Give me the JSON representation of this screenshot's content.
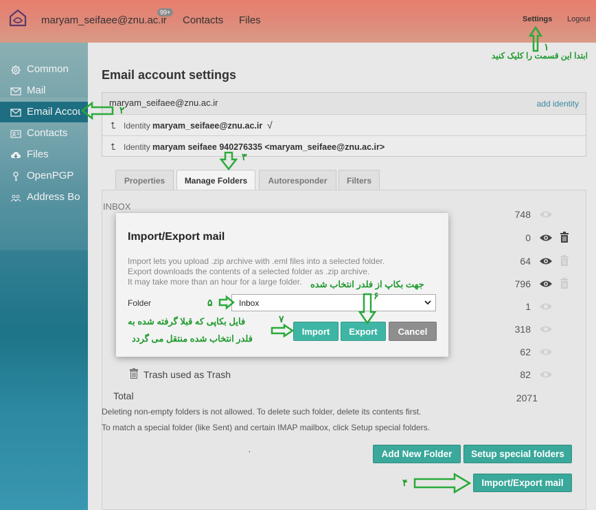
{
  "topbar": {
    "user": "maryam_seifaee@znu.ac.ir",
    "badge": "99+",
    "contacts": "Contacts",
    "files": "Files",
    "settings": "Settings",
    "logout": "Logout"
  },
  "sidebar": {
    "items": [
      {
        "label": "Common",
        "icon": "gear-icon"
      },
      {
        "label": "Mail",
        "icon": "envelope-icon"
      },
      {
        "label": "Email Accounts",
        "icon": "envelope-icon"
      },
      {
        "label": "Contacts",
        "icon": "contact-card-icon"
      },
      {
        "label": "Files",
        "icon": "cloud-download-icon"
      },
      {
        "label": "OpenPGP",
        "icon": "key-icon"
      },
      {
        "label": "Address Book",
        "icon": "people-icon"
      }
    ]
  },
  "main": {
    "title": "Email account settings",
    "account": "maryam_seifaee@znu.ac.ir",
    "add_identity": "add identity",
    "identity_prefix": "Identity",
    "identities": [
      {
        "name": "maryam_seifaee@znu.ac.ir",
        "check": "√"
      },
      {
        "name": "maryam seifaee 940276335 <maryam_seifaee@znu.ac.ir>",
        "check": ""
      }
    ],
    "tabs": [
      "Properties",
      "Manage Folders",
      "Autoresponder",
      "Filters"
    ],
    "first_folder_partial": "INBOX",
    "folder_counts": [
      "748",
      "0",
      "64",
      "796",
      "1",
      "318",
      "62"
    ],
    "trash_row": {
      "name": "Trash used as Trash",
      "count": "82"
    },
    "total_label": "Total",
    "total_value": "2071",
    "note1": "Deleting non-empty folders is not allowed. To delete such folder, delete its contents first.",
    "note2": "To match a special folder (like Sent) and certain IMAP mailbox, click Setup special folders.",
    "add_folder": "Add New Folder",
    "setup_special": "Setup special folders",
    "import_export": "Import/Export mail"
  },
  "modal": {
    "title": "Import/Export mail",
    "desc": [
      "Import lets you upload .zip archive with .eml files into a selected folder.",
      "Export downloads the contents of a selected folder as .zip archive.",
      "It may take more than an hour for a large folder."
    ],
    "folder_label": "Folder",
    "folder_value": "Inbox",
    "import": "Import",
    "export": "Export",
    "cancel": "Cancel"
  },
  "annotations": {
    "n1": "۱",
    "a1": "ابتدا این قسمت را کلیک کنید",
    "n2": "۲",
    "n3": "۳",
    "n4": "۴",
    "n5": "۵",
    "n6": "۶",
    "a6": "جهت بکاپ از فلدر انتخاب شده",
    "n7": "۷",
    "a7a": "فایل بکاپی که قبلا گرفته شده به",
    "a7b": "فلدر انتخاب شده منتقل می گردد",
    "dot": "."
  },
  "colors": {
    "accent": "#3aa89a",
    "annotation": "#1e9a2c",
    "active_nav": "#1e6e82"
  }
}
